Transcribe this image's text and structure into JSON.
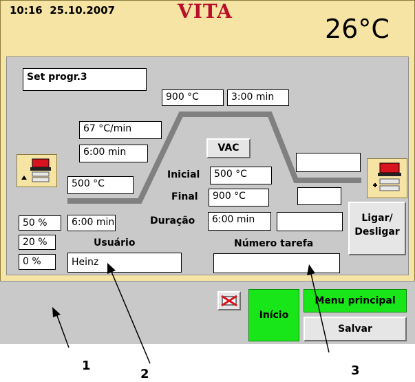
{
  "header": {
    "time": "10:16",
    "date": "25.10.2007",
    "brand": "VITA",
    "temperature": "26°C"
  },
  "program": {
    "name": "Set progr.3"
  },
  "profile": {
    "hold_temp": "900 °C",
    "hold_time": "3:00 min",
    "rate": "67 °C/min",
    "heat_time": "6:00 min",
    "start_temp": "500 °C",
    "vac_label": "VAC",
    "vac_start_label": "Inicial",
    "vac_start_value": "500 °C",
    "vac_end_label": "Final",
    "vac_end_value": "900 °C",
    "vac_duration_label": "Duração",
    "vac_duration_value": "6:00 min",
    "lift_time": "6:00 min",
    "right_field_1": "",
    "right_field_2": "",
    "right_field_3": ""
  },
  "lift_levels": [
    "50 %",
    "20 %",
    "0 %"
  ],
  "user": {
    "label": "Usuário",
    "value": "Heinz"
  },
  "task": {
    "label": "Número tarefa",
    "value": ""
  },
  "buttons": {
    "power": "Ligar/\nDesligar",
    "start": "Início",
    "main_menu": "Menu principal",
    "save": "Salvar"
  },
  "annotations": [
    "1",
    "2",
    "3"
  ],
  "colors": {
    "panel": "#f6e4a5",
    "content": "#c9c9c9",
    "brand": "#b8102a",
    "curve": "#808080",
    "start_button": "#19e619"
  }
}
